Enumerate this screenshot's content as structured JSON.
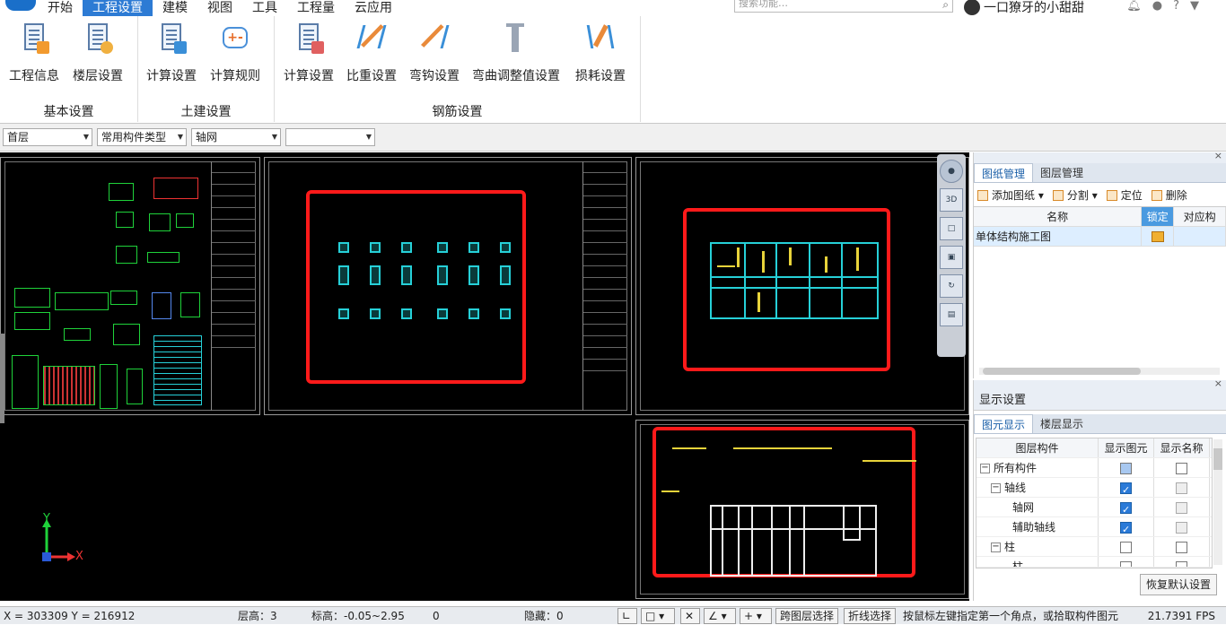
{
  "menu": {
    "items": [
      "开始",
      "工程设置",
      "建模",
      "视图",
      "工具",
      "工程量",
      "云应用"
    ],
    "active": "工程设置"
  },
  "search": {
    "placeholder": "搜索功能…"
  },
  "user": {
    "name": "一口獠牙的小甜甜"
  },
  "ribbon": {
    "groups": [
      {
        "title": "基本设置",
        "buttons": [
          "工程信息",
          "楼层设置"
        ]
      },
      {
        "title": "土建设置",
        "buttons": [
          "计算设置",
          "计算规则"
        ]
      },
      {
        "title": "钢筋设置",
        "buttons": [
          "计算设置",
          "比重设置",
          "弯钩设置",
          "弯曲调整值设置",
          "损耗设置"
        ]
      }
    ]
  },
  "toolbar": {
    "floor": "首层",
    "type": "常用构件类型",
    "component": "轴网",
    "extra": ""
  },
  "canvas": {
    "axis_x": "X",
    "axis_y": "Y"
  },
  "viewtools": {
    "label3d": "3D"
  },
  "drawings_panel": {
    "tabs": [
      "图纸管理",
      "图层管理"
    ],
    "tools": [
      "添加图纸",
      "分割",
      "定位",
      "删除"
    ],
    "columns": [
      "名称",
      "锁定",
      "对应构"
    ],
    "rows": [
      {
        "name": "单体结构施工图"
      }
    ]
  },
  "display_panel": {
    "title": "显示设置",
    "tabs": [
      "图元显示",
      "楼层显示"
    ],
    "columns": [
      "图层构件",
      "显示图元",
      "显示名称"
    ],
    "tree": [
      "所有构件",
      "轴线",
      "轴网",
      "辅助轴线",
      "柱",
      "柱"
    ],
    "restore": "恢复默认设置"
  },
  "status": {
    "coords": "X = 303309 Y = 216912",
    "floor_height": "层高：3",
    "elevation": "标高：-0.05~2.95",
    "zero": "0",
    "hidden": "隐藏：0",
    "cross_layer": "跨图层选择",
    "polyline": "折线选择",
    "hint": "按鼠标左键指定第一个角点，或拾取构件图元",
    "fps": "21.7391 FPS"
  }
}
